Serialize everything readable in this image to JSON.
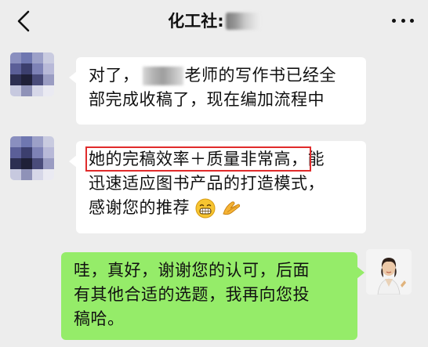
{
  "header": {
    "title": "化工社:"
  },
  "messages": [
    {
      "side": "left",
      "line1_before": "对了，",
      "line1_after": "老师的写作书已经全",
      "line2": "部完成收稿了，现在编加流程中"
    },
    {
      "side": "left",
      "highlight": "她的完稿效率＋质量非常高，",
      "line1_rest": "能",
      "line2": "迅速适应图书产品的打造模式，",
      "line3": "感谢您的推荐"
    },
    {
      "side": "right",
      "line1": "哇，真好，谢谢您的认可，后面",
      "line2": "有其他合适的选题，我再向您投",
      "line3": "稿哈。"
    }
  ],
  "icons": {
    "back": "chevron-left-icon",
    "more": "more-dots-icon",
    "emoji1": "grin-emoji-icon",
    "emoji2": "clap-emoji-icon"
  },
  "colors": {
    "background": "#ededed",
    "incoming_bubble": "#ffffff",
    "outgoing_bubble": "#95ec69",
    "highlight_box": "#e02b2b"
  }
}
